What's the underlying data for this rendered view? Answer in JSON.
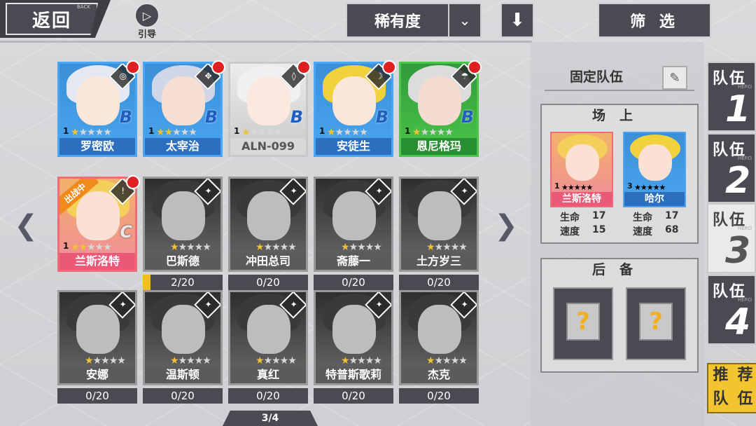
{
  "header": {
    "back_label": "返回",
    "back_sub": "BACK",
    "guide_label": "引导",
    "rarity_label": "稀有度",
    "filter_label": "筛 选"
  },
  "pager": "3/4",
  "heroes_row1": [
    {
      "name": "罗密欧",
      "level": "1",
      "stars": 1,
      "rank": "B",
      "bg": "#3a8fd8",
      "frame": "#4aa6ef",
      "namebar": "#2c6fbf",
      "hair": "#e4e8f2",
      "skin": "#fbe6da",
      "cls": "◎"
    },
    {
      "name": "太宰治",
      "level": "1",
      "stars": 2,
      "rank": "B",
      "bg": "#3a8fd8",
      "frame": "#4aa6ef",
      "namebar": "#2c6fbf",
      "hair": "#cfd6e8",
      "skin": "#f5dfd2",
      "cls": "✥"
    },
    {
      "name": "ALN-099",
      "level": "1",
      "stars": 1,
      "rank": "B",
      "bg": "#ececec",
      "frame": "#c9c9c9",
      "namebar": "#d8d8d8",
      "hair": "#f0f0f2",
      "skin": "#fbe9df",
      "cls": "◊"
    },
    {
      "name": "安徒生",
      "level": "1",
      "stars": 1,
      "rank": "B",
      "bg": "#3a8fd8",
      "frame": "#4aa6ef",
      "namebar": "#2c6fbf",
      "hair": "#f1d23c",
      "skin": "#fbe6da",
      "cls": "☽"
    },
    {
      "name": "恩尼格玛",
      "level": "1",
      "stars": 1,
      "rank": "B",
      "bg": "#2f9a3a",
      "frame": "#4cc64a",
      "namebar": "#278f31",
      "hair": "#dcdcdc",
      "skin": "#f3dbcf",
      "cls": "☂"
    }
  ],
  "heroes_row2": [
    {
      "name": "兰斯洛特",
      "level": "1",
      "stars": 2,
      "rank": "C",
      "active": true,
      "tag": "出战中",
      "progress": ""
    },
    {
      "name": "巴斯德",
      "progress": "2/20",
      "progress_value": 0.1
    },
    {
      "name": "冲田总司",
      "progress": "0/20",
      "progress_value": 0
    },
    {
      "name": "斋藤一",
      "progress": "0/20",
      "progress_value": 0
    },
    {
      "name": "土方岁三",
      "progress": "0/20",
      "progress_value": 0
    }
  ],
  "heroes_row3": [
    {
      "name": "安娜",
      "progress": "0/20",
      "progress_value": 0
    },
    {
      "name": "温斯顿",
      "progress": "0/20",
      "progress_value": 0
    },
    {
      "name": "真红",
      "progress": "0/20",
      "progress_value": 0
    },
    {
      "name": "特普斯歌莉",
      "progress": "0/20",
      "progress_value": 0
    },
    {
      "name": "杰克",
      "progress": "0/20",
      "progress_value": 0
    }
  ],
  "panel": {
    "fixed_team": "固定队伍",
    "onfield_title": "场上",
    "reserve_title": "后备",
    "onfield": [
      {
        "name": "兰斯洛特",
        "level": "1",
        "stars": 2,
        "hp_label": "生命",
        "hp": "17",
        "spd_label": "速度",
        "spd": "15"
      },
      {
        "name": "哈尔",
        "level": "3",
        "stars": 2,
        "hp_label": "生命",
        "hp": "17",
        "spd_label": "速度",
        "spd": "68"
      }
    ],
    "reserve_slots": [
      "?",
      "?"
    ]
  },
  "teams": [
    {
      "label": "队伍",
      "sub": "HERO",
      "num": "1"
    },
    {
      "label": "队伍",
      "sub": "HERO",
      "num": "2"
    },
    {
      "label": "队伍",
      "sub": "HERO",
      "num": "3"
    },
    {
      "label": "队伍",
      "sub": "HERO",
      "num": "4"
    }
  ],
  "active_team_index": 2,
  "recommend": [
    "推",
    "荐",
    "队",
    "伍"
  ]
}
